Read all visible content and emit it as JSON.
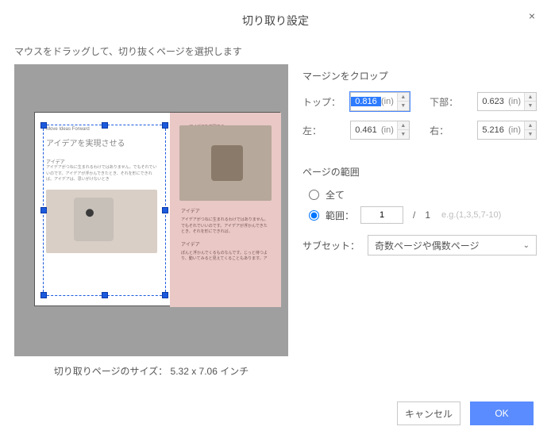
{
  "dialog": {
    "title": "切り取り設定",
    "close": "×",
    "instruction": "マウスをドラッグして、切り抜くページを選択します",
    "crop_size_label": "切り取りページのサイズ：",
    "crop_size_value": "5.32 x 7.06 インチ"
  },
  "margins": {
    "section_title": "マージンをクロップ",
    "top_label": "トップ：",
    "top_value": "0.816",
    "top_unit": "(in)",
    "bottom_label": "下部：",
    "bottom_value": "0.623",
    "bottom_unit": "(in)",
    "left_label": "左：",
    "left_value": "0.461",
    "left_unit": "(in)",
    "right_label": "右：",
    "right_value": "5.216",
    "right_unit": "(in)"
  },
  "page_range": {
    "section_title": "ページの範囲",
    "all_label": "全て",
    "range_label": "範囲：",
    "range_value": "1",
    "slash": "/",
    "total": "1",
    "example": "e.g.(1,3,5,7-10)",
    "subset_label": "サブセット：",
    "subset_value": "奇数ページや偶数ページ"
  },
  "buttons": {
    "cancel": "キャンセル",
    "ok": "OK"
  },
  "preview_text": {
    "kicker": "Move Ideas Forward",
    "heading": "アイデアを実現させる",
    "sub": "アイデア",
    "right_tag": "アイデアを実現する"
  }
}
